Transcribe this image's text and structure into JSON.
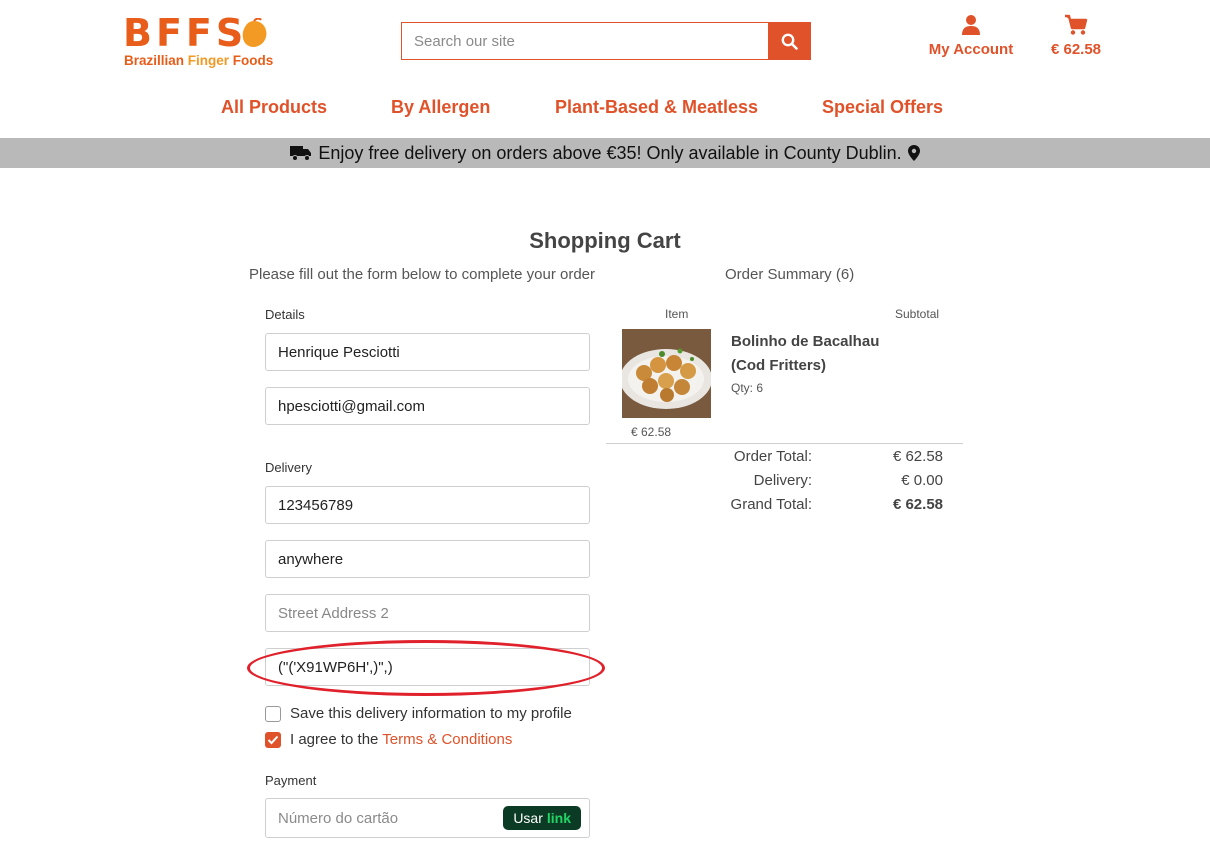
{
  "brand": {
    "logo_text": "BFFS",
    "tagline_part1": "Brazillian ",
    "tagline_part2": "Finger",
    "tagline_part3": " Foods"
  },
  "header": {
    "search_placeholder": "Search our site",
    "account_label": "My Account",
    "cart_total": "€ 62.58"
  },
  "nav": {
    "items": [
      {
        "label": "All Products"
      },
      {
        "label": "By Allergen"
      },
      {
        "label": "Plant-Based & Meatless"
      },
      {
        "label": "Special Offers"
      }
    ]
  },
  "banner": {
    "text": "Enjoy free delivery on orders above €35! Only available in County Dublin."
  },
  "page": {
    "title": "Shopping Cart",
    "form_intro": "Please fill out the form below to complete your order",
    "summary_title": "Order Summary (6)"
  },
  "form": {
    "details_label": "Details",
    "full_name": "Henrique Pesciotti",
    "email": "hpesciotti@gmail.com",
    "delivery_label": "Delivery",
    "phone": "123456789",
    "street_address1": "anywhere",
    "street_address2_placeholder": "Street Address 2",
    "postcode": "(\"('X91WP6H',)\",)",
    "save_info_label": "Save this delivery information to my profile",
    "save_info_checked": false,
    "agree_prefix": "I agree to the ",
    "terms_link": "Terms & Conditions",
    "agree_checked": true,
    "payment_label": "Payment",
    "card_placeholder": "Número do cartão",
    "link_button_prefix": "Usar",
    "link_button_brand": "link"
  },
  "summary": {
    "col_item": "Item",
    "col_subtotal": "Subtotal",
    "product": {
      "name": "Bolinho de Bacalhau (Cod Fritters)",
      "qty": "Qty: 6",
      "price": "€ 62.58"
    },
    "order_total_label": "Order Total:",
    "order_total": "€ 62.58",
    "delivery_label": "Delivery:",
    "delivery": "€ 0.00",
    "grand_total_label": "Grand Total:",
    "grand_total": "€ 62.58"
  },
  "colors": {
    "accent": "#e0522a",
    "banner_bg": "#b9b9b9",
    "highlight_ring": "#e0202a"
  }
}
